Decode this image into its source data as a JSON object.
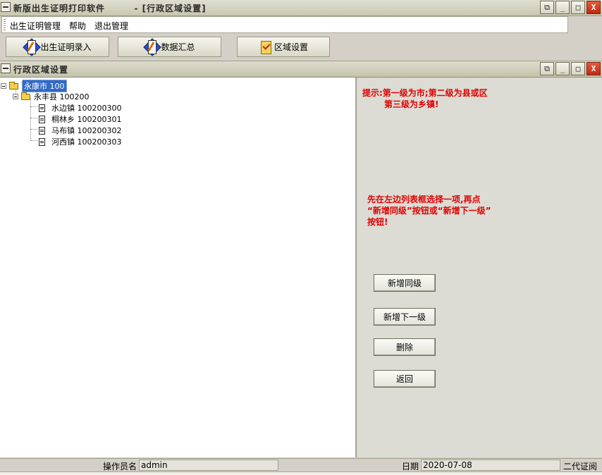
{
  "window": {
    "title": "新版出生证明打印软件",
    "subtitle": "- [行政区域设置]",
    "min_label": "_",
    "max_label": "□",
    "close_label": "X"
  },
  "menu": {
    "items": [
      "出生证明管理",
      "帮助",
      "退出管理"
    ]
  },
  "toolbar": {
    "buttons": [
      "出生证明录入",
      "数据汇总",
      "区域设置"
    ]
  },
  "child_window": {
    "title": "行政区域设置"
  },
  "tree": {
    "root": {
      "label": "永康市 100"
    },
    "county": {
      "label": "永丰县 100200"
    },
    "towns": [
      {
        "label": "水边镇 100200300"
      },
      {
        "label": "桐林乡 100200301"
      },
      {
        "label": "马布镇 100200302"
      },
      {
        "label": "河西镇 100200303"
      }
    ]
  },
  "hints": {
    "line1": "提示:第一级为市;第二级为县或区",
    "line2": "第三级为乡镇!",
    "line3": "先在左边列表框选择一项,再点",
    "line4": "“新增同级”按钮或“新增下一级”",
    "line5": "按钮!"
  },
  "actions": {
    "add_same": "新增同级",
    "add_child": "新增下一级",
    "delete": "删除",
    "back": "返回"
  },
  "status": {
    "operator_label": "操作员名",
    "operator_value": "admin",
    "date_label": "日期",
    "date_value": "2020-07-08",
    "id_label": "二代证阅"
  }
}
